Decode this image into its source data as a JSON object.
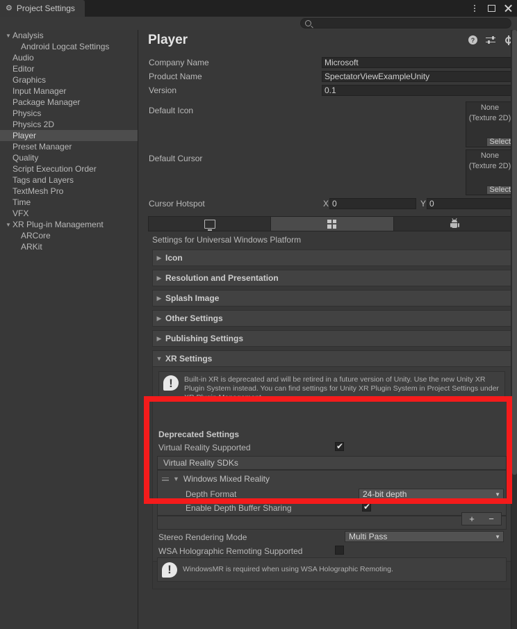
{
  "window": {
    "tab_label": "Project Settings",
    "tab_icon": "gear-icon",
    "controls": {
      "menu": "kebab-menu-icon",
      "maximize": "maximize-icon",
      "close": "close-icon"
    }
  },
  "search": {
    "value": "",
    "placeholder": "",
    "icon": "search-icon"
  },
  "sidebar": {
    "items": [
      {
        "label": "Analysis",
        "level": 0,
        "expandable": true,
        "expanded": true,
        "selected": false
      },
      {
        "label": "Android Logcat Settings",
        "level": 1,
        "expandable": false,
        "expanded": false,
        "selected": false
      },
      {
        "label": "Audio",
        "level": 0,
        "expandable": false,
        "expanded": false,
        "selected": false
      },
      {
        "label": "Editor",
        "level": 0,
        "expandable": false,
        "expanded": false,
        "selected": false
      },
      {
        "label": "Graphics",
        "level": 0,
        "expandable": false,
        "expanded": false,
        "selected": false
      },
      {
        "label": "Input Manager",
        "level": 0,
        "expandable": false,
        "expanded": false,
        "selected": false
      },
      {
        "label": "Package Manager",
        "level": 0,
        "expandable": false,
        "expanded": false,
        "selected": false
      },
      {
        "label": "Physics",
        "level": 0,
        "expandable": false,
        "expanded": false,
        "selected": false
      },
      {
        "label": "Physics 2D",
        "level": 0,
        "expandable": false,
        "expanded": false,
        "selected": false
      },
      {
        "label": "Player",
        "level": 0,
        "expandable": false,
        "expanded": false,
        "selected": true
      },
      {
        "label": "Preset Manager",
        "level": 0,
        "expandable": false,
        "expanded": false,
        "selected": false
      },
      {
        "label": "Quality",
        "level": 0,
        "expandable": false,
        "expanded": false,
        "selected": false
      },
      {
        "label": "Script Execution Order",
        "level": 0,
        "expandable": false,
        "expanded": false,
        "selected": false
      },
      {
        "label": "Tags and Layers",
        "level": 0,
        "expandable": false,
        "expanded": false,
        "selected": false
      },
      {
        "label": "TextMesh Pro",
        "level": 0,
        "expandable": false,
        "expanded": false,
        "selected": false
      },
      {
        "label": "Time",
        "level": 0,
        "expandable": false,
        "expanded": false,
        "selected": false
      },
      {
        "label": "VFX",
        "level": 0,
        "expandable": false,
        "expanded": false,
        "selected": false
      },
      {
        "label": "XR Plug-in Management",
        "level": 0,
        "expandable": true,
        "expanded": true,
        "selected": false
      },
      {
        "label": "ARCore",
        "level": 1,
        "expandable": false,
        "expanded": false,
        "selected": false
      },
      {
        "label": "ARKit",
        "level": 1,
        "expandable": false,
        "expanded": false,
        "selected": false
      }
    ]
  },
  "main": {
    "title": "Player",
    "header_icons": [
      {
        "name": "help-icon",
        "glyph": "?"
      },
      {
        "name": "preset-icon"
      },
      {
        "name": "settings-gear-icon"
      }
    ],
    "fields": {
      "company_name": {
        "label": "Company Name",
        "value": "Microsoft"
      },
      "product_name": {
        "label": "Product Name",
        "value": "SpectatorViewExampleUnity"
      },
      "version": {
        "label": "Version",
        "value": "0.1"
      },
      "default_icon": {
        "label": "Default Icon",
        "value": "None",
        "type": "(Texture 2D)",
        "select_label": "Select"
      },
      "default_cursor": {
        "label": "Default Cursor",
        "value": "None",
        "type": "(Texture 2D)",
        "select_label": "Select"
      },
      "cursor_hotspot": {
        "label": "Cursor Hotspot",
        "x_label": "X",
        "x_value": "0",
        "y_label": "Y",
        "y_value": "0"
      }
    },
    "platform_tabs": [
      {
        "name": "standalone",
        "icon": "monitor-icon",
        "selected": false
      },
      {
        "name": "uwp",
        "icon": "windows-icon",
        "selected": true
      },
      {
        "name": "android",
        "icon": "android-icon",
        "selected": false
      }
    ],
    "settings_for": "Settings for Universal Windows Platform",
    "sections": [
      {
        "label": "Icon",
        "expanded": false
      },
      {
        "label": "Resolution and Presentation",
        "expanded": false
      },
      {
        "label": "Splash Image",
        "expanded": false
      },
      {
        "label": "Other Settings",
        "expanded": false
      },
      {
        "label": "Publishing Settings",
        "expanded": false
      },
      {
        "label": "XR Settings",
        "expanded": true
      }
    ],
    "xr": {
      "deprecation_warning": "Built-in XR is deprecated and will be retired in a future version of Unity. Use the new Unity XR Plugin System instead. You can find settings for Unity XR Plugin System in Project Settings under XR Plugin Management.",
      "deprecated_settings_label": "Deprecated Settings",
      "virtual_reality_supported": {
        "label": "Virtual Reality Supported",
        "checked": true
      },
      "sdk_list_header": "Virtual Reality SDKs",
      "sdk_entry": {
        "name": "Windows Mixed Reality",
        "expanded": true,
        "depth_format": {
          "label": "Depth Format",
          "value": "24-bit depth"
        },
        "enable_depth_buffer_sharing": {
          "label": "Enable Depth Buffer Sharing",
          "checked": true
        }
      },
      "list_buttons": {
        "add": "+",
        "remove": "−"
      },
      "stereo_rendering_mode": {
        "label": "Stereo Rendering Mode",
        "value": "Multi Pass"
      },
      "wsa_holographic_remoting": {
        "label": "WSA Holographic Remoting Supported",
        "checked": false
      },
      "remoting_info": "WindowsMR is required when using WSA Holographic Remoting."
    }
  },
  "highlight": {
    "color": "#f41b1b",
    "name": "red-highlight-box"
  }
}
